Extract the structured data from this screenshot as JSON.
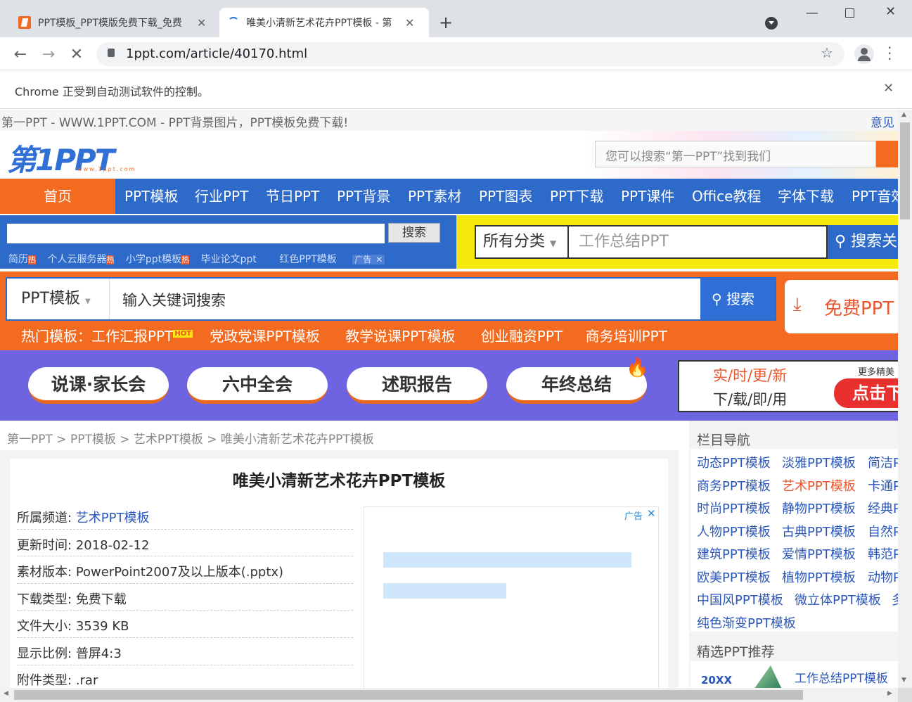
{
  "browser": {
    "tabs": [
      {
        "title": "PPT模板_PPT模版免费下载_免费"
      },
      {
        "title": "唯美小清新艺术花卉PPT模板 - 第"
      }
    ],
    "url": "1ppt.com/article/40170.html",
    "infobar": "Chrome 正受到自动测试软件的控制。"
  },
  "site": {
    "top_strip": "第一PPT - WWW.1PPT.COM - PPT背景图片，PPT模板免费下载!",
    "feedback": "意见",
    "logo_text": "第1PPT",
    "logo_sub": "www.1ppt.com",
    "header_search_placeholder": "您可以搜索“第一PPT”找到我们",
    "nav": [
      "首页",
      "PPT模板",
      "行业PPT",
      "节日PPT",
      "PPT背景",
      "PPT素材",
      "PPT图表",
      "PPT下载",
      "PPT课件",
      "Office教程",
      "字体下载",
      "PPT音效"
    ],
    "ad_search_button": "搜索",
    "ad_links": [
      "简历",
      "个人云服务器",
      "小学ppt模板",
      "毕业论文ppt",
      "红色PPT模板"
    ],
    "hot_mark": "热",
    "ad_mark": "广告",
    "cat_select": "所有分类",
    "cat_search_value": "工作总结PPT",
    "cat_search_button": "搜索关",
    "banner_select": "PPT模板",
    "banner_search_placeholder": "输入关键词搜索",
    "banner_search_button": "搜索",
    "banner_free": "免费PPT",
    "hot_prefix": "热门模板：",
    "hot_links": [
      "工作汇报PPT",
      "党政党课PPT模板",
      "教学说课PPT模板",
      "创业融资PPT",
      "商务培训PPT"
    ],
    "hot_badge": "HOT",
    "pills": [
      "说课·家长会",
      "六中全会",
      "述职报告",
      "年终总结"
    ],
    "side_ad_line1": "实/时/更/新",
    "side_ad_line2": "下/载/即/用",
    "side_ad_more": "更多精美",
    "side_ad_button": "点击下"
  },
  "breadcrumb": [
    "第一PPT",
    "PPT模板",
    "艺术PPT模板",
    "唯美小清新艺术花卉PPT模板"
  ],
  "article": {
    "title": "唯美小清新艺术花卉PPT模板",
    "fields": [
      {
        "label": "所属频道:",
        "value": "艺术PPT模板"
      },
      {
        "label": "更新时间:",
        "value": "2018-02-12"
      },
      {
        "label": "素材版本:",
        "value": "PowerPoint2007及以上版本(.pptx)"
      },
      {
        "label": "下载类型:",
        "value": "免费下载"
      },
      {
        "label": "文件大小:",
        "value": "3539 KB"
      },
      {
        "label": "显示比例:",
        "value": "普屏4:3"
      },
      {
        "label": "附件类型:",
        "value": ".rar"
      }
    ],
    "ad_label": "广告"
  },
  "sidebar": {
    "nav_title": "栏目导航",
    "categories": [
      [
        "动态PPT模板",
        "淡雅PPT模板",
        "简洁P"
      ],
      [
        "商务PPT模板",
        "艺术PPT模板",
        "卡通P"
      ],
      [
        "时尚PPT模板",
        "静物PPT模板",
        "经典P"
      ],
      [
        "人物PPT模板",
        "古典PPT模板",
        "自然P"
      ],
      [
        "建筑PPT模板",
        "爱情PPT模板",
        "韩范P"
      ],
      [
        "欧美PPT模板",
        "植物PPT模板",
        "动物P"
      ],
      [
        "中国风PPT模板",
        "微立体PPT模板",
        "多"
      ],
      [
        "纯色渐变PPT模板"
      ]
    ],
    "recommend_title": "精选PPT推荐",
    "recommend_item": "工作总结PPT模板",
    "recommend_year": "20XX"
  },
  "colors": {
    "orange": "#f26b21",
    "blue": "#2d6ac9",
    "nav_blue": "#2f6fd6",
    "highlight": "#e8552e"
  }
}
